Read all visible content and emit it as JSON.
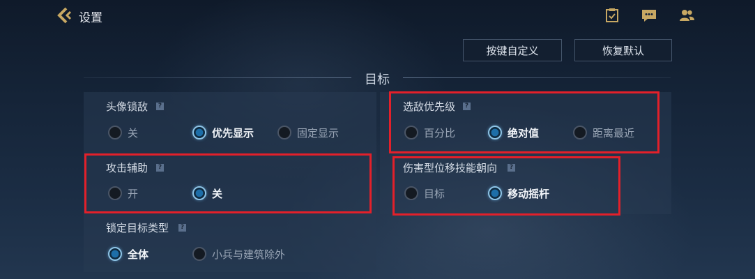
{
  "header": {
    "title": "设置",
    "icons": [
      "back-chevron-icon",
      "checklist-icon",
      "chat-icon",
      "friends-icon"
    ]
  },
  "actions": {
    "key_custom": "按键自定义",
    "reset_default": "恢复默认"
  },
  "section": {
    "title": "目标"
  },
  "settings": {
    "avatar_lock": {
      "label": "头像锁敌",
      "options": [
        "关",
        "优先显示",
        "固定显示"
      ],
      "selected": "优先显示"
    },
    "enemy_priority": {
      "label": "选敌优先级",
      "options": [
        "百分比",
        "绝对值",
        "距离最近"
      ],
      "selected": "绝对值"
    },
    "attack_assist": {
      "label": "攻击辅助",
      "options": [
        "开",
        "关"
      ],
      "selected": "关"
    },
    "damage_skill_direction": {
      "label": "伤害型位移技能朝向",
      "options": [
        "目标",
        "移动摇杆"
      ],
      "selected": "移动摇杆"
    },
    "lock_target_type": {
      "label": "锁定目标类型",
      "options": [
        "全体",
        "小兵与建筑除外"
      ],
      "selected": "全体"
    }
  },
  "help_glyph": "?",
  "colors": {
    "accent_gold": "#c8a863",
    "highlight_red": "#e3202a",
    "radio_on": "#1d6ea8"
  }
}
